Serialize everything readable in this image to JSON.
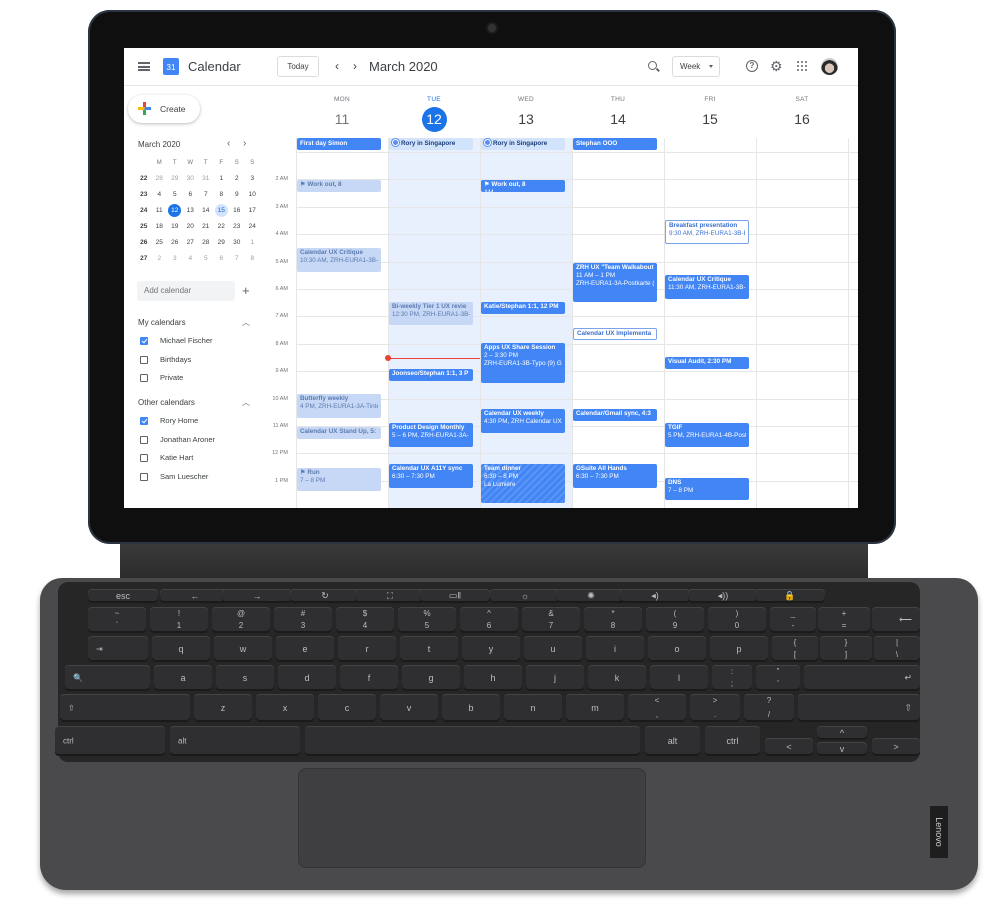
{
  "header": {
    "logo_day": "31",
    "app_title": "Calendar",
    "today_label": "Today",
    "prev_label": "‹",
    "next_label": "›",
    "current_period": "March 2020",
    "view_select": "Week",
    "help_glyph": "?",
    "gear_glyph": "⚙"
  },
  "sidebar": {
    "create_label": "Create",
    "mini_calendar": {
      "title": "March 2020",
      "prev": "‹",
      "next": "›",
      "weekday_headers": [
        "",
        "M",
        "T",
        "W",
        "T",
        "F",
        "S",
        "S"
      ],
      "weeks": [
        {
          "wk": "22",
          "days": [
            {
              "d": "28",
              "dim": true
            },
            {
              "d": "29",
              "dim": true
            },
            {
              "d": "30",
              "dim": true
            },
            {
              "d": "31",
              "dim": true
            },
            {
              "d": "1"
            },
            {
              "d": "2"
            },
            {
              "d": "3"
            }
          ]
        },
        {
          "wk": "23",
          "days": [
            {
              "d": "4"
            },
            {
              "d": "5"
            },
            {
              "d": "6"
            },
            {
              "d": "7"
            },
            {
              "d": "8"
            },
            {
              "d": "9"
            },
            {
              "d": "10"
            }
          ]
        },
        {
          "wk": "24",
          "days": [
            {
              "d": "11"
            },
            {
              "d": "12",
              "selected": true
            },
            {
              "d": "13"
            },
            {
              "d": "14"
            },
            {
              "d": "15",
              "highlight": true
            },
            {
              "d": "16"
            },
            {
              "d": "17"
            }
          ]
        },
        {
          "wk": "25",
          "days": [
            {
              "d": "18"
            },
            {
              "d": "19"
            },
            {
              "d": "20"
            },
            {
              "d": "21"
            },
            {
              "d": "22"
            },
            {
              "d": "23"
            },
            {
              "d": "24"
            }
          ]
        },
        {
          "wk": "26",
          "days": [
            {
              "d": "25"
            },
            {
              "d": "26"
            },
            {
              "d": "27"
            },
            {
              "d": "28"
            },
            {
              "d": "29"
            },
            {
              "d": "30"
            },
            {
              "d": "1",
              "dim": true
            }
          ]
        },
        {
          "wk": "27",
          "days": [
            {
              "d": "2",
              "dim": true
            },
            {
              "d": "3",
              "dim": true
            },
            {
              "d": "4",
              "dim": true
            },
            {
              "d": "5",
              "dim": true
            },
            {
              "d": "6",
              "dim": true
            },
            {
              "d": "7",
              "dim": true
            },
            {
              "d": "8",
              "dim": true
            }
          ]
        }
      ]
    },
    "add_calendar_placeholder": "Add calendar",
    "add_calendar_plus": "+",
    "my_calendars": {
      "title": "My calendars",
      "items": [
        {
          "name": "Michael Fischer",
          "checked": true
        },
        {
          "name": "Birthdays",
          "checked": false
        },
        {
          "name": "Private",
          "checked": false
        }
      ]
    },
    "other_calendars": {
      "title": "Other calendars",
      "items": [
        {
          "name": "Rory Horne",
          "checked": true
        },
        {
          "name": "Jonathan Aroner",
          "checked": false
        },
        {
          "name": "Katie Hart",
          "checked": false
        },
        {
          "name": "Sam Luescher",
          "checked": false
        }
      ]
    }
  },
  "week": {
    "days": [
      {
        "dow": "MON",
        "num": "11",
        "state": "past"
      },
      {
        "dow": "TUE",
        "num": "12",
        "state": "today"
      },
      {
        "dow": "WED",
        "num": "13",
        "state": "future"
      },
      {
        "dow": "THU",
        "num": "14",
        "state": "future"
      },
      {
        "dow": "FRI",
        "num": "15",
        "state": "future"
      },
      {
        "dow": "SAT",
        "num": "16",
        "state": "future"
      }
    ],
    "time_labels": [
      "2 AM",
      "3 AM",
      "4 AM",
      "5 AM",
      "6 AM",
      "7 AM",
      "8 AM",
      "9 AM",
      "10 AM",
      "11 AM",
      "12 PM",
      "1 PM"
    ],
    "all_day_events": [
      {
        "day": 0,
        "title": "First day Simon",
        "style": "solid"
      },
      {
        "day": 1,
        "title": "Rory in Singapore",
        "style": "light",
        "icon": true
      },
      {
        "day": 2,
        "title": "Rory in Singapore",
        "style": "light",
        "icon": true
      },
      {
        "day": 3,
        "title": "Stephan OOO",
        "style": "solid"
      }
    ],
    "events": [
      {
        "day": 0,
        "slot": 1.0,
        "len": 0.5,
        "title": "Work out, 8",
        "sub": "",
        "style": "light",
        "flag": true
      },
      {
        "day": 0,
        "slot": 3.45,
        "len": 0.95,
        "title": "Calendar UX Critique",
        "sub": "10:30 AM, ZRH-EURA1-3B-",
        "style": "light"
      },
      {
        "day": 0,
        "slot": 8.8,
        "len": 0.95,
        "title": "Butterfly weekly",
        "sub": "4 PM, ZRH-EURA1-3A-Tinte",
        "style": "light"
      },
      {
        "day": 0,
        "slot": 10.0,
        "len": 0.5,
        "title": "Calendar UX Stand Up, 5:",
        "sub": "",
        "style": "light"
      },
      {
        "day": 0,
        "slot": 11.5,
        "len": 0.9,
        "title": "Run",
        "sub": "7 – 8 PM",
        "style": "light",
        "flag": true
      },
      {
        "day": 1,
        "slot": 5.45,
        "len": 0.9,
        "title": "Bi-weekly Tier 1 UX revie",
        "sub": "12:30 PM, ZRH-EURA1-3B-",
        "style": "light"
      },
      {
        "day": 1,
        "slot": 7.9,
        "len": 0.5,
        "title": "Joonseo/Stephan 1:1, 3 P",
        "sub": "",
        "style": "solid"
      },
      {
        "day": 1,
        "slot": 9.85,
        "len": 0.95,
        "title": "Product Design Monthly",
        "sub": "5 – 6 PM, ZRH-EURA1-3A-",
        "style": "solid"
      },
      {
        "day": 1,
        "slot": 11.35,
        "len": 0.95,
        "title": "Calendar UX A11Y sync",
        "sub": "6:30 – 7:30 PM",
        "style": "solid"
      },
      {
        "day": 2,
        "slot": 1.0,
        "len": 0.5,
        "title": "Work out, 8",
        "sub": "AM",
        "style": "solid",
        "flag": true
      },
      {
        "day": 2,
        "slot": 5.45,
        "len": 0.5,
        "title": "Katie/Stephan 1:1, 12 PM",
        "sub": "",
        "style": "solid"
      },
      {
        "day": 2,
        "slot": 6.95,
        "len": 1.5,
        "title": "Apps UX Share Session",
        "sub": "2 – 3:30 PM",
        "sub2": "ZRH-EURA1-3B-Typo (9) G",
        "style": "solid"
      },
      {
        "day": 2,
        "slot": 9.35,
        "len": 0.95,
        "title": "Calendar UX weekly",
        "sub": "4:30 PM, ZRH Calendar UX",
        "style": "solid"
      },
      {
        "day": 2,
        "slot": 11.35,
        "len": 1.5,
        "title": "Team dinner",
        "sub": "6:30 – 8 PM",
        "sub2": "La Lumière",
        "style": "hatched"
      },
      {
        "day": 3,
        "slot": 4.0,
        "len": 1.5,
        "title": "ZRH UX \"Team Walkabout\"",
        "sub": "11 AM – 1 PM",
        "sub2": "ZRH-EURA1-3A-Postkarte (",
        "style": "solid"
      },
      {
        "day": 3,
        "slot": 6.4,
        "len": 0.5,
        "title": "Calendar UX Implementa",
        "sub": "",
        "style": "outline"
      },
      {
        "day": 3,
        "slot": 9.35,
        "len": 0.5,
        "title": "Calendar/Gmail sync, 4:3",
        "sub": "",
        "style": "solid"
      },
      {
        "day": 3,
        "slot": 11.35,
        "len": 0.95,
        "title": "GSuite All Hands",
        "sub": "6:30 – 7:30 PM",
        "style": "solid"
      },
      {
        "day": 4,
        "slot": 2.45,
        "len": 0.95,
        "title": "Breakfast presentation",
        "sub": "9:30 AM, ZRH-EURA1-3B-E",
        "style": "outline"
      },
      {
        "day": 4,
        "slot": 4.45,
        "len": 0.95,
        "title": "Calendar UX Critique",
        "sub": "11:30 AM, ZRH-EURA1-3B-",
        "style": "solid"
      },
      {
        "day": 4,
        "slot": 7.45,
        "len": 0.5,
        "title": "Visual Audit, 2:30 PM",
        "sub": "",
        "style": "solid"
      },
      {
        "day": 4,
        "slot": 9.85,
        "len": 0.95,
        "title": "TGIF",
        "sub": "5 PM, ZRH-EURA1-4B-Posti",
        "style": "solid"
      },
      {
        "day": 4,
        "slot": 11.85,
        "len": 0.9,
        "title": "DNS",
        "sub": "7 – 8 PM",
        "style": "solid"
      }
    ]
  },
  "keyboard": {
    "rows": [
      [
        {
          "m": "esc"
        },
        {
          "m": "←"
        },
        {
          "m": "→"
        },
        {
          "m": "↻"
        },
        {
          "m": "⛶"
        },
        {
          "m": "▭‖"
        },
        {
          "m": "☼"
        },
        {
          "m": "✺"
        },
        {
          "m": "◂)"
        },
        {
          "m": "◂))"
        },
        {
          "m": "🔒"
        }
      ],
      [
        {
          "t": "~",
          "b": "`"
        },
        {
          "t": "!",
          "b": "1"
        },
        {
          "t": "@",
          "b": "2"
        },
        {
          "t": "#",
          "b": "3"
        },
        {
          "t": "$",
          "b": "4"
        },
        {
          "t": "%",
          "b": "5"
        },
        {
          "t": "^",
          "b": "6"
        },
        {
          "t": "&",
          "b": "7"
        },
        {
          "t": "*",
          "b": "8"
        },
        {
          "t": "(",
          "b": "9"
        },
        {
          "t": ")",
          "b": "0"
        },
        {
          "t": "_",
          "b": "-"
        },
        {
          "t": "+",
          "b": "="
        },
        {
          "r": "⟵"
        }
      ],
      [
        {
          "l": "⇥"
        },
        {
          "m": "q"
        },
        {
          "m": "w"
        },
        {
          "m": "e"
        },
        {
          "m": "r"
        },
        {
          "m": "t"
        },
        {
          "m": "y"
        },
        {
          "m": "u"
        },
        {
          "m": "i"
        },
        {
          "m": "o"
        },
        {
          "m": "p"
        },
        {
          "t": "{",
          "b": "["
        },
        {
          "t": "}",
          "b": "]"
        },
        {
          "t": "|",
          "b": "\\"
        }
      ],
      [
        {
          "l": "🔍"
        },
        {
          "m": "a"
        },
        {
          "m": "s"
        },
        {
          "m": "d"
        },
        {
          "m": "f"
        },
        {
          "m": "g"
        },
        {
          "m": "h"
        },
        {
          "m": "j"
        },
        {
          "m": "k"
        },
        {
          "m": "l"
        },
        {
          "t": ":",
          "b": ";"
        },
        {
          "t": "\"",
          "b": "'"
        },
        {
          "r": "↵"
        }
      ],
      [
        {
          "l": "⇧"
        },
        {
          "m": "z"
        },
        {
          "m": "x"
        },
        {
          "m": "c"
        },
        {
          "m": "v"
        },
        {
          "m": "b"
        },
        {
          "m": "n"
        },
        {
          "m": "m"
        },
        {
          "t": "<",
          "b": ","
        },
        {
          "t": ">",
          "b": "."
        },
        {
          "t": "?",
          "b": "/"
        },
        {
          "r": "⇧"
        }
      ],
      [
        {
          "l": "ctrl"
        },
        {
          "l": "alt"
        },
        {
          "m": ""
        },
        {
          "m": "alt"
        },
        {
          "m": "ctrl"
        },
        {
          "m": "<"
        },
        {
          "m": "^"
        },
        {
          "m": "v"
        },
        {
          "m": ">"
        }
      ]
    ],
    "brand": "Lenovo"
  }
}
